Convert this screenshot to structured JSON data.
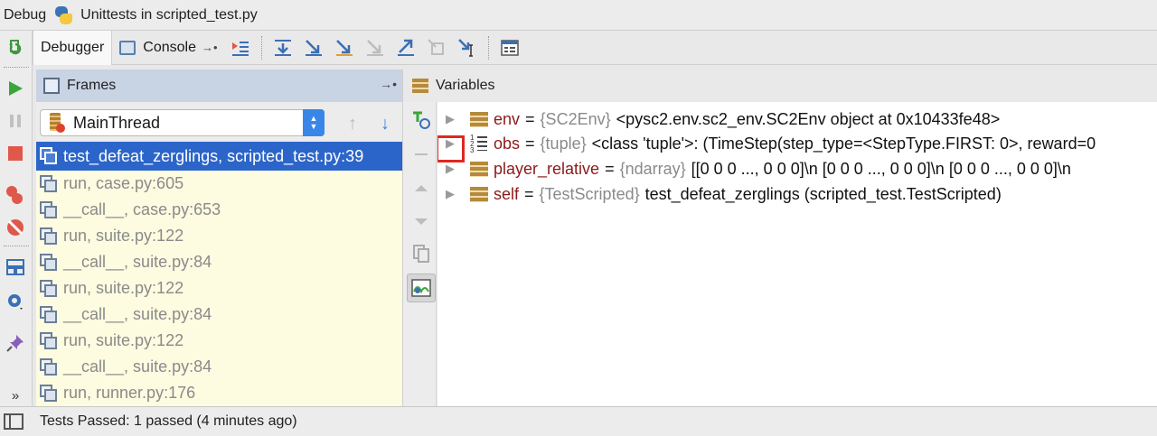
{
  "titlebar": {
    "debug_label": "Debug",
    "config_name": "Unittests in scripted_test.py"
  },
  "toolbar": {
    "tabs": [
      {
        "label": "Debugger",
        "active": true
      },
      {
        "label": "Console",
        "active": false
      }
    ],
    "icons": [
      "show-execution-point-icon",
      "step-over-icon",
      "step-into-icon",
      "step-into-my-code-icon",
      "force-step-into-icon",
      "step-out-icon",
      "drop-frame-icon",
      "run-to-cursor-icon",
      "evaluate-expression-icon"
    ]
  },
  "left_toolbar": {
    "icons": [
      "rerun-icon",
      "resume-icon",
      "pause-icon",
      "stop-icon",
      "view-breakpoints-icon",
      "mute-breakpoints-icon",
      "restore-layout-icon",
      "settings-icon",
      "pin-icon",
      "more-icon"
    ],
    "more_label": "»"
  },
  "frames": {
    "header": "Frames",
    "thread": "MainThread",
    "items": [
      {
        "label": "test_defeat_zerglings, scripted_test.py:39",
        "selected": true
      },
      {
        "label": "run, case.py:605",
        "selected": false
      },
      {
        "label": "__call__, case.py:653",
        "selected": false
      },
      {
        "label": "run, suite.py:122",
        "selected": false
      },
      {
        "label": "__call__, suite.py:84",
        "selected": false
      },
      {
        "label": "run, suite.py:122",
        "selected": false
      },
      {
        "label": "__call__, suite.py:84",
        "selected": false
      },
      {
        "label": "run, suite.py:122",
        "selected": false
      },
      {
        "label": "__call__, suite.py:84",
        "selected": false
      },
      {
        "label": "run, runner.py:176",
        "selected": false
      }
    ]
  },
  "variables": {
    "header": "Variables",
    "items": [
      {
        "name": "env",
        "eq": "=",
        "type": "{SC2Env}",
        "value": "<pysc2.env.sc2_env.SC2Env object at 0x10433fe48>",
        "icon": "stack-icon"
      },
      {
        "name": "obs",
        "eq": "=",
        "type": "{tuple}",
        "value": "<class 'tuple'>: (TimeStep(step_type=<StepType.FIRST: 0>, reward=0",
        "icon": "list-icon"
      },
      {
        "name": "player_relative",
        "eq": "=",
        "type": "{ndarray}",
        "value": "[[0 0 0 ..., 0 0 0]\\n [0 0 0 ..., 0 0 0]\\n [0 0 0 ..., 0 0 0]\\n",
        "icon": "stack-icon"
      },
      {
        "name": "self",
        "eq": "=",
        "type": "{TestScripted}",
        "value": "test_defeat_zerglings (scripted_test.TestScripted)",
        "icon": "stack-icon"
      }
    ]
  },
  "status": {
    "text": "Tests Passed: 1 passed (4 minutes ago)"
  },
  "colors": {
    "selection": "#2c65c9",
    "frames_bg": "#fdfbe0",
    "var_name": "#8c1a1a",
    "highlight": "#e0281f"
  }
}
